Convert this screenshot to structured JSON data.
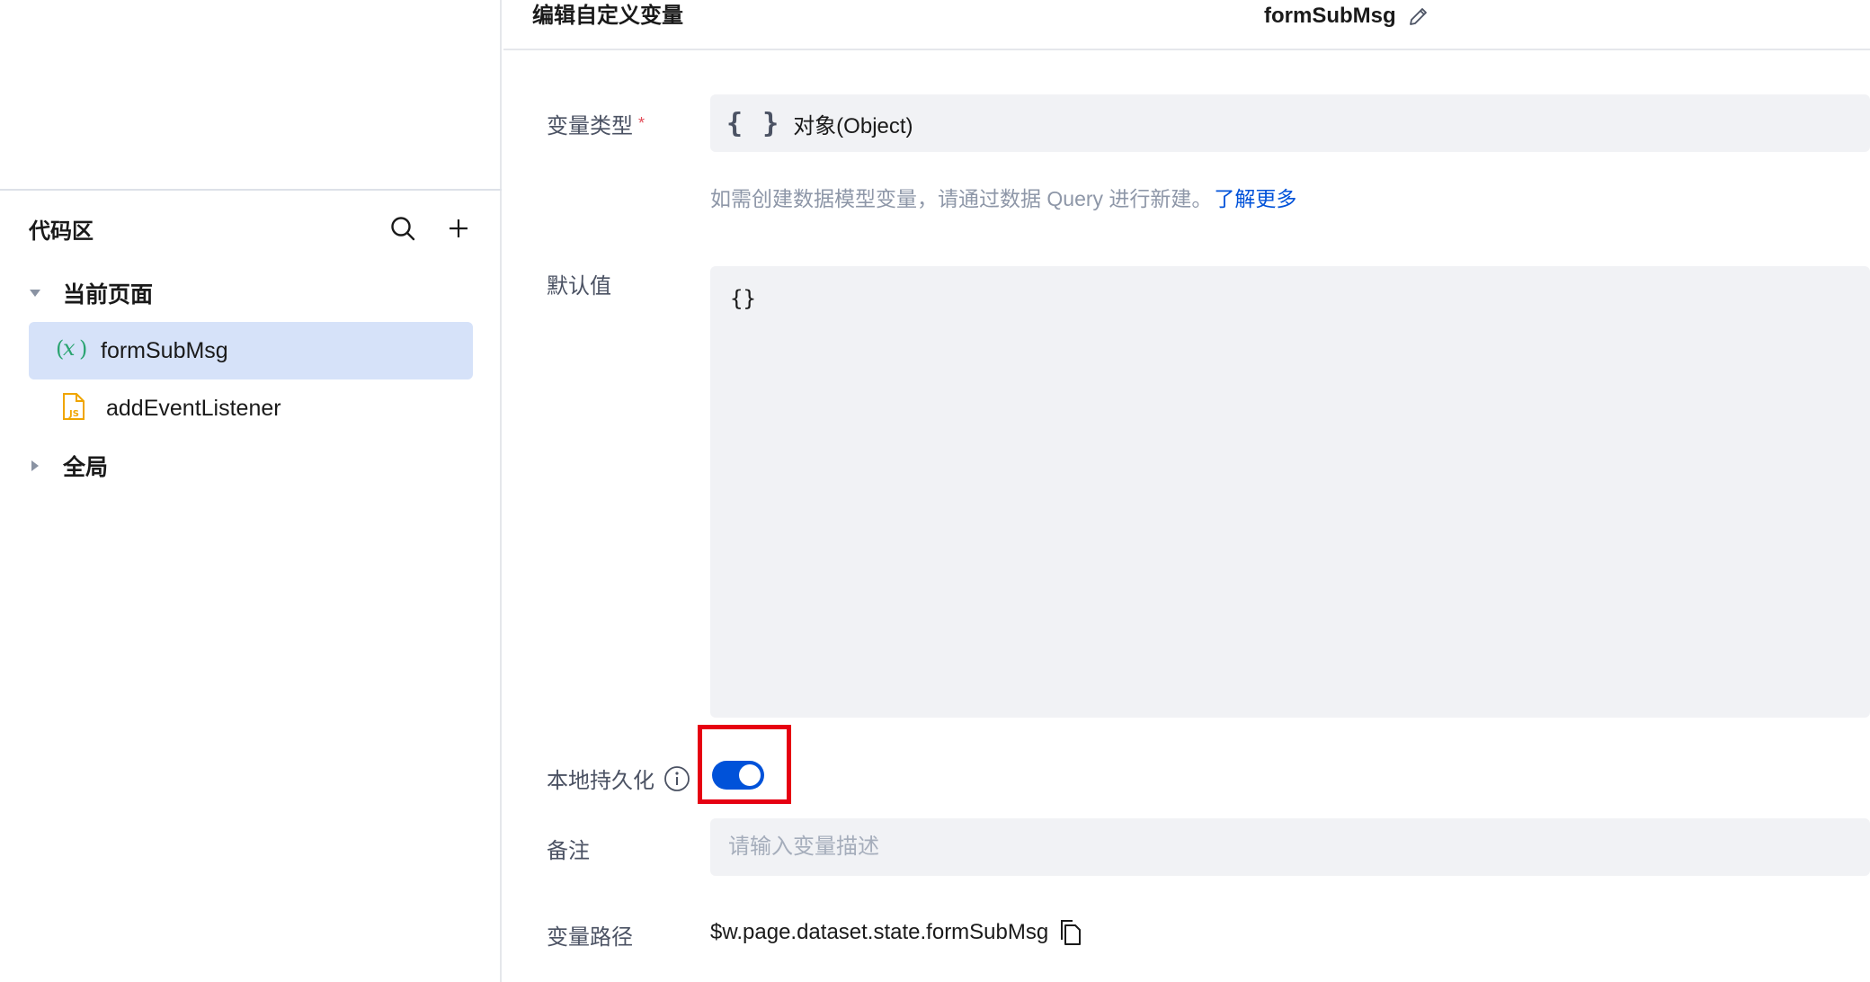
{
  "sidebar": {
    "code_area_title": "代码区",
    "groups": [
      {
        "label": "当前页面",
        "expanded": true
      },
      {
        "label": "全局",
        "expanded": false
      }
    ],
    "items": [
      {
        "label": "formSubMsg",
        "icon": "variable-icon",
        "active": true
      },
      {
        "label": "addEventListener",
        "icon": "js-file-icon",
        "active": false
      }
    ]
  },
  "header": {
    "title": "编辑自定义变量",
    "variable_name": "formSubMsg"
  },
  "form": {
    "type_label": "变量类型",
    "required_mark": "*",
    "type_icon": "{ }",
    "type_value": "对象(Object)",
    "hint_text": "如需创建数据模型变量，请通过数据 Query 进行新建。",
    "hint_link": "了解更多",
    "default_label": "默认值",
    "default_value": "{}",
    "persist_label": "本地持久化",
    "persist_enabled": true,
    "remark_label": "备注",
    "remark_placeholder": "请输入变量描述",
    "remark_value": "",
    "path_label": "变量路径",
    "path_value": "$w.page.dataset.state.formSubMsg"
  },
  "colors": {
    "accent": "#0052d9",
    "active_item_bg": "#d6e2f9",
    "highlight_box": "#e60012",
    "variable_icon": "#2ba471",
    "js_icon": "#f0a500"
  }
}
